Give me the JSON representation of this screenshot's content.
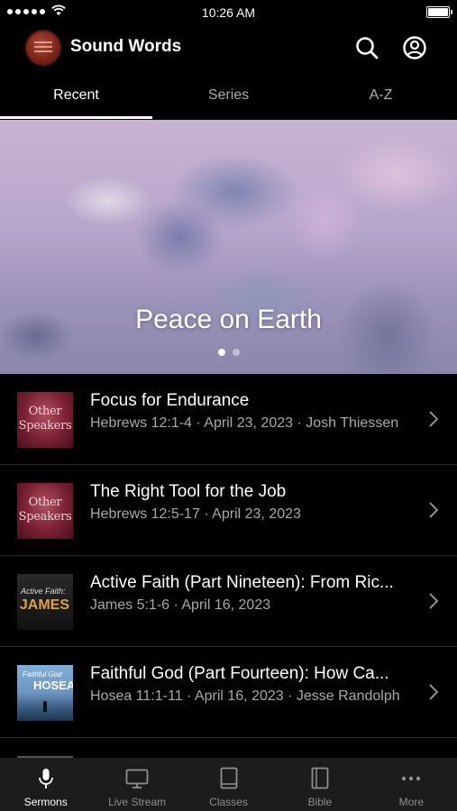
{
  "status_bar": {
    "time": "10:26 AM"
  },
  "header": {
    "title": "Sound Words"
  },
  "tabs": [
    {
      "label": "Recent",
      "active": true
    },
    {
      "label": "Series",
      "active": false
    },
    {
      "label": "A-Z",
      "active": false
    }
  ],
  "hero": {
    "title": "Peace on Earth",
    "page_count": 2,
    "current_page": 1
  },
  "sermons": [
    {
      "title": "Focus for Endurance",
      "meta": "Hebrews 12:1-4 · April 23, 2023 · Josh Thiessen",
      "thumb": "Other Speakers"
    },
    {
      "title": "The Right Tool for the Job",
      "meta": "Hebrews 12:5-17 · April 23, 2023",
      "thumb": "Other Speakers"
    },
    {
      "title": "Active Faith (Part Nineteen): From Ric...",
      "meta": "James 5:1-6 · April 16, 2023",
      "thumb": "Active Faith: JAMES"
    },
    {
      "title": "Faithful God (Part Fourteen): How Ca...",
      "meta": "Hosea 11:1-11 · April 16, 2023 · Jesse Randolph",
      "thumb": "Faithful God HOSEA"
    }
  ],
  "thumbs": {
    "other_line1": "Other",
    "other_line2": "Speakers",
    "james_line1": "Active Faith:",
    "james_line2": "JAMES",
    "hosea_line1": "Faithful God",
    "hosea_line2": "HOSEA"
  },
  "tab_bar": [
    {
      "label": "Sermons",
      "icon": "microphone-icon",
      "active": true
    },
    {
      "label": "Live Stream",
      "icon": "monitor-icon",
      "active": false
    },
    {
      "label": "Classes",
      "icon": "book-icon",
      "active": false
    },
    {
      "label": "Bible",
      "icon": "bible-icon",
      "active": false
    },
    {
      "label": "More",
      "icon": "ellipsis-icon",
      "active": false
    }
  ],
  "colors": {
    "background": "#000000",
    "tab_bar": "#1c1c1e",
    "secondary_text": "#a8a8a8"
  }
}
